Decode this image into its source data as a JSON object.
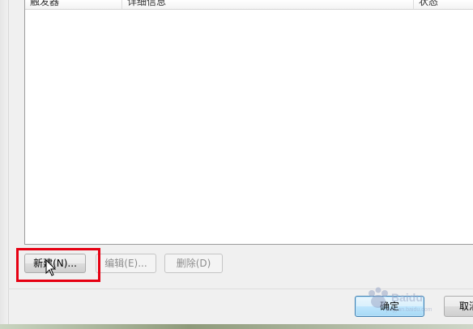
{
  "list": {
    "columns": [
      {
        "label": "触发器"
      },
      {
        "label": "详细信息"
      },
      {
        "label": "状态"
      }
    ],
    "rows": []
  },
  "buttons": {
    "new_label": "新建(N)...",
    "edit_label": "编辑(E)...",
    "delete_label": "删除(D)",
    "ok_label": "确定",
    "cancel_label": "取消"
  },
  "colors": {
    "highlight": "#e60012",
    "default_button_border": "#3c7fb1"
  },
  "icons": {
    "cursor": "arrow-cursor-icon",
    "watermark": "baidu-watermark"
  }
}
